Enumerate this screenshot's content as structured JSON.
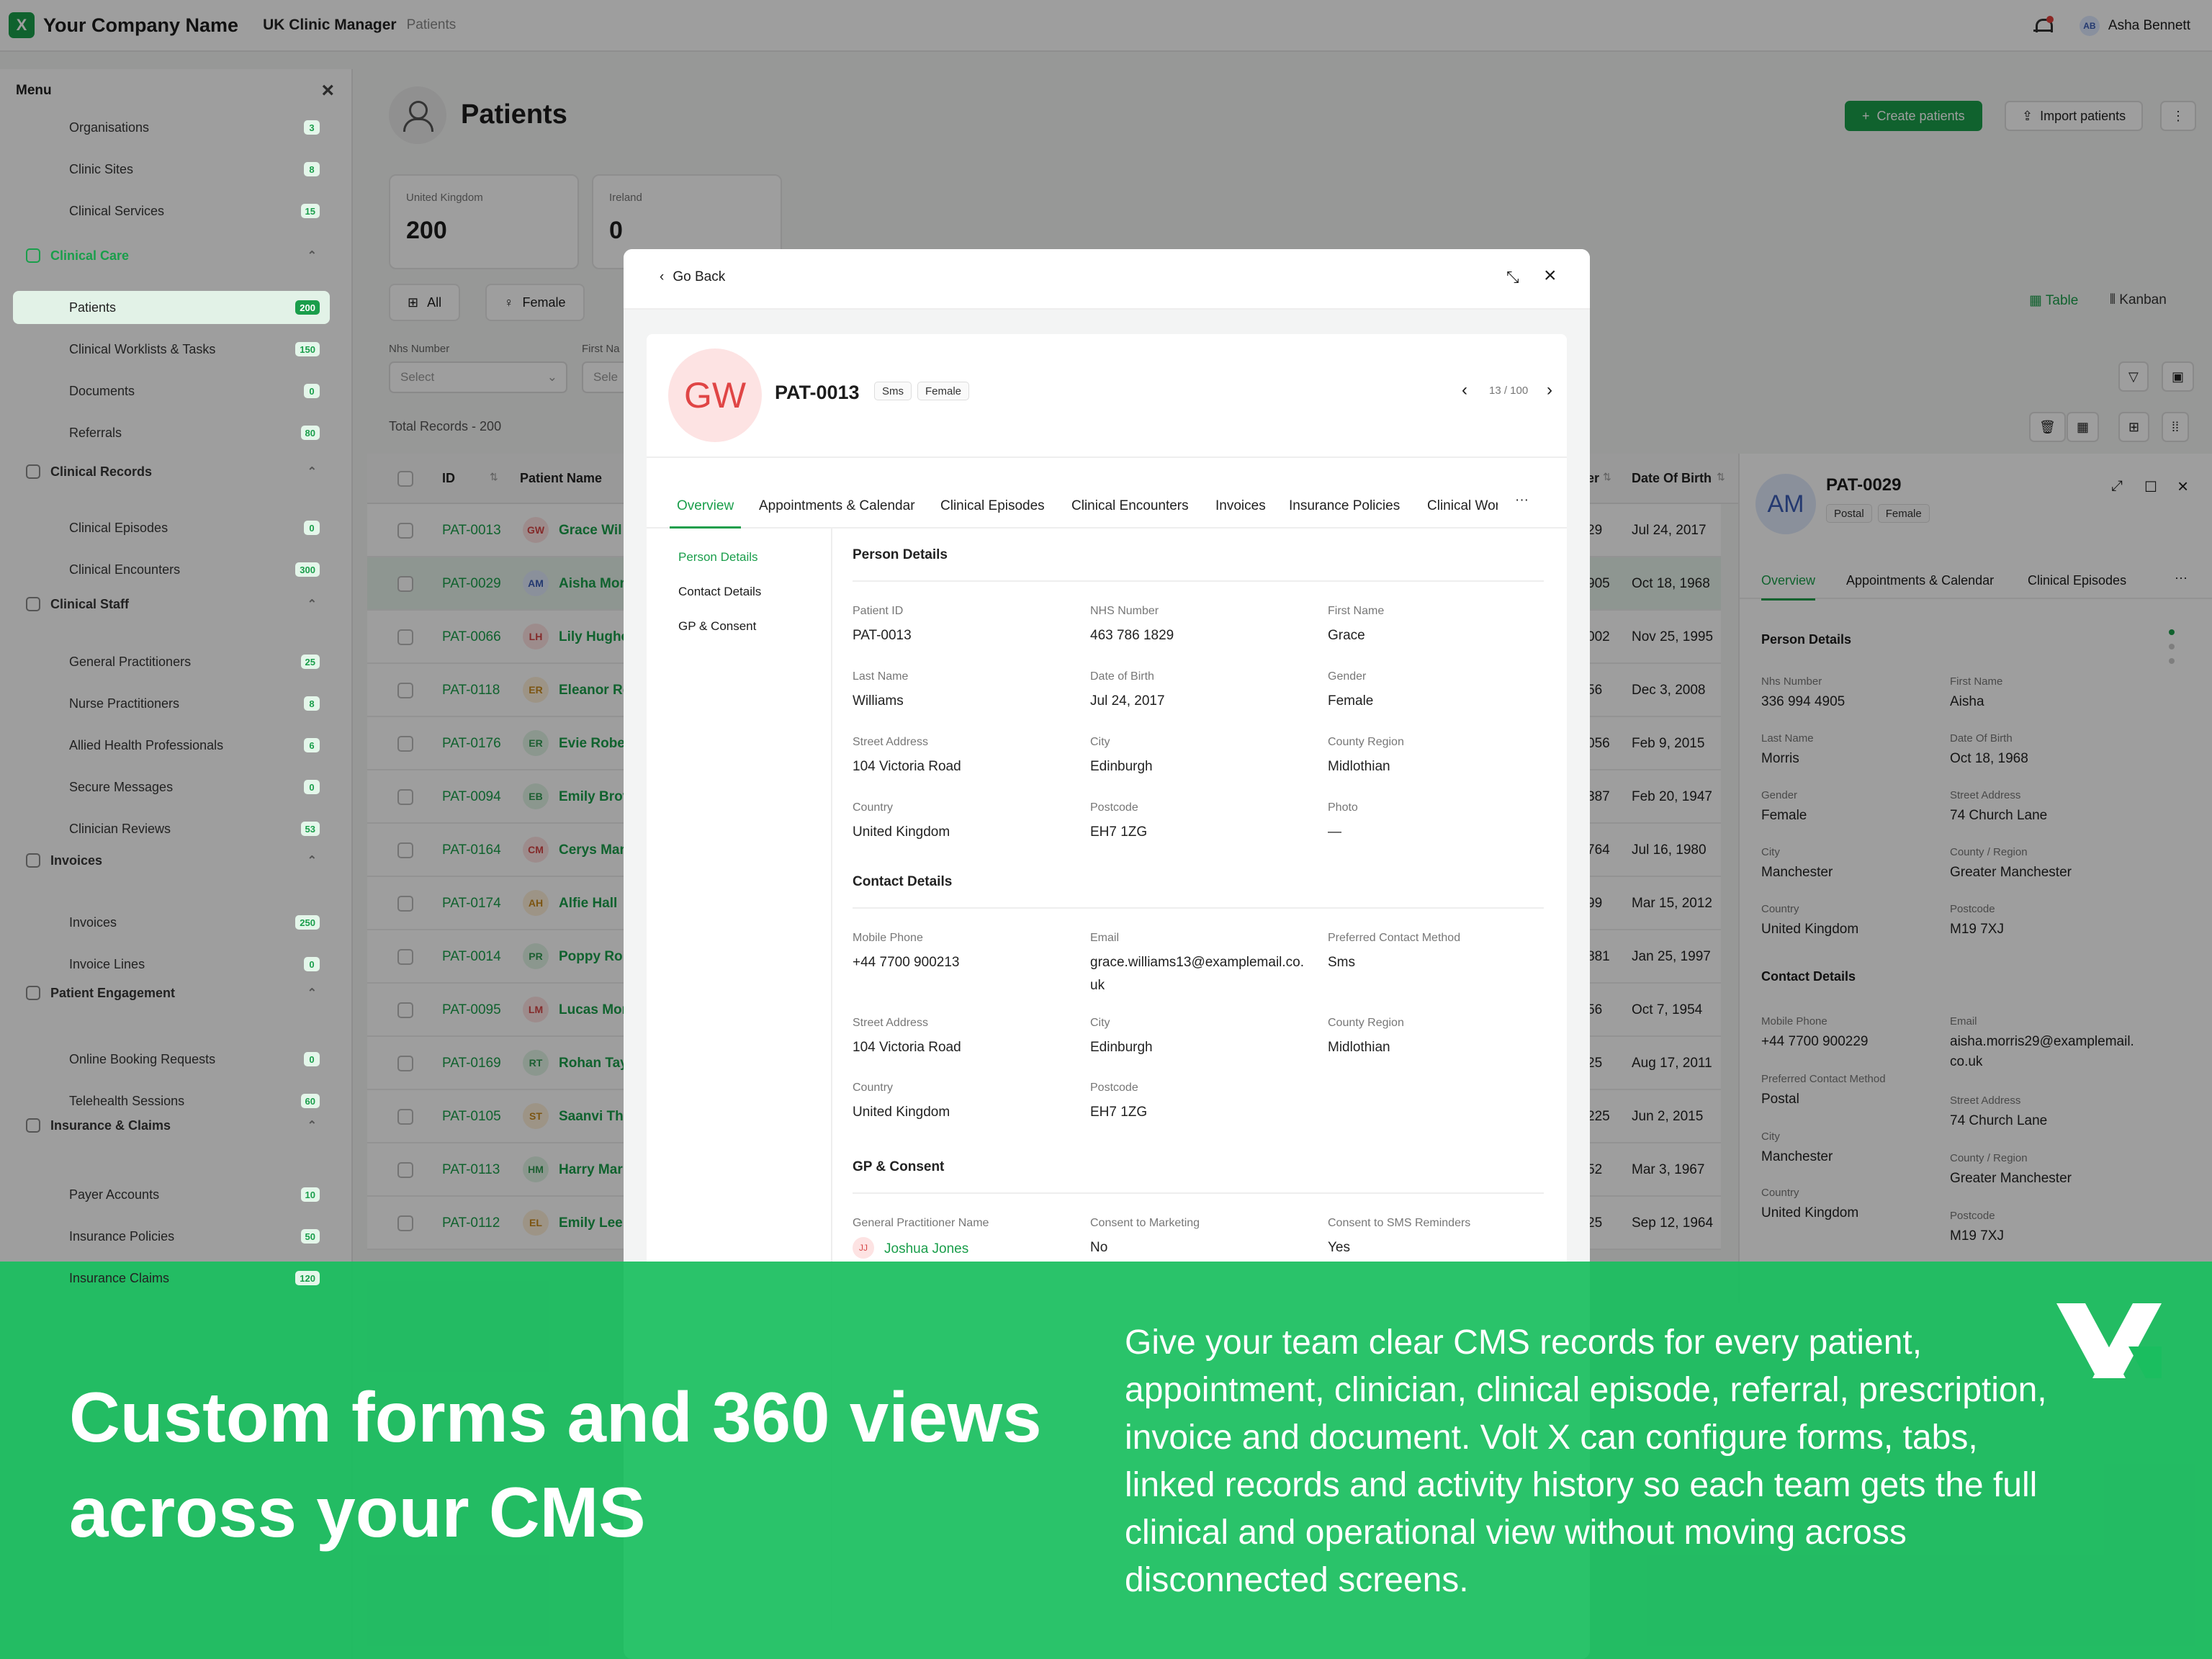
{
  "topbar": {
    "logo": "X",
    "company": "Your Company Name",
    "app": "UK Clinic Manager",
    "crumb": "Patients",
    "user_initials": "AB",
    "user": "Asha Bennett"
  },
  "sidebar": {
    "title": "Menu",
    "items": [
      {
        "label": "Organisations",
        "count": "3"
      },
      {
        "label": "Clinic Sites",
        "count": "8"
      },
      {
        "label": "Clinical Services",
        "count": "15"
      },
      {
        "label": "Patients",
        "count": "200"
      },
      {
        "label": "Clinical Worklists & Tasks",
        "count": "150"
      },
      {
        "label": "Documents",
        "count": "0"
      },
      {
        "label": "Referrals",
        "count": "80"
      },
      {
        "label": "Clinical Episodes",
        "count": "0"
      },
      {
        "label": "Clinical Encounters",
        "count": "300"
      },
      {
        "label": "General Practitioners",
        "count": "25"
      },
      {
        "label": "Nurse Practitioners",
        "count": "8"
      },
      {
        "label": "Allied Health Professionals",
        "count": "6"
      },
      {
        "label": "Secure Messages",
        "count": "0"
      },
      {
        "label": "Clinician Reviews",
        "count": "53"
      },
      {
        "label": "Invoices",
        "count": "250"
      },
      {
        "label": "Invoice Lines",
        "count": "0"
      },
      {
        "label": "Online Booking Requests",
        "count": "0"
      },
      {
        "label": "Telehealth Sessions",
        "count": "60"
      },
      {
        "label": "Payer Accounts",
        "count": "10"
      },
      {
        "label": "Insurance Policies",
        "count": "50"
      },
      {
        "label": "Insurance Claims",
        "count": "120"
      }
    ],
    "groups": [
      "Clinical Care",
      "Clinical Records",
      "Clinical Staff",
      "Invoices",
      "Patient Engagement",
      "Insurance & Claims"
    ]
  },
  "page": {
    "title": "Patients",
    "create": "Create patients",
    "import": "Import patients",
    "stats": [
      {
        "label": "United Kingdom",
        "value": "200"
      },
      {
        "label": "Ireland",
        "value": "0"
      }
    ],
    "filters": {
      "all": "All",
      "female": "Female"
    },
    "views": {
      "table": "Table",
      "kanban": "Kanban"
    },
    "filter_labels": {
      "nhs": "Nhs Number",
      "first": "First Na"
    },
    "select": "Select",
    "select2": "Sele",
    "total": "Total Records - 200",
    "columns": {
      "id": "ID",
      "name": "Patient Name",
      "col_er": "er",
      "dob": "Date Of Birth"
    }
  },
  "rows": [
    {
      "id": "PAT-0013",
      "ini": "GW",
      "name": "Grace Wil",
      "num": "29",
      "dob": "Jul 24, 2017",
      "bg": "#fde3e3",
      "fg": "#d64545"
    },
    {
      "id": "PAT-0029",
      "ini": "AM",
      "name": "Aisha Mor",
      "num": "905",
      "dob": "Oct 18, 1968",
      "bg": "#dfe8fb",
      "fg": "#3a5db5"
    },
    {
      "id": "PAT-0066",
      "ini": "LH",
      "name": "Lily Hughe",
      "num": "002",
      "dob": "Nov 25, 1995",
      "bg": "#fde3e3",
      "fg": "#d64545"
    },
    {
      "id": "PAT-0118",
      "ini": "ER",
      "name": "Eleanor Re",
      "num": "56",
      "dob": "Dec 3, 2008",
      "bg": "#fdefd8",
      "fg": "#c98a1e"
    },
    {
      "id": "PAT-0176",
      "ini": "ER",
      "name": "Evie Robe",
      "num": "056",
      "dob": "Feb 9, 2015",
      "bg": "#e1f4e6",
      "fg": "#2f9a52"
    },
    {
      "id": "PAT-0094",
      "ini": "EB",
      "name": "Emily Brov",
      "num": "387",
      "dob": "Feb 20, 1947",
      "bg": "#e1f4e6",
      "fg": "#2f9a52"
    },
    {
      "id": "PAT-0164",
      "ini": "CM",
      "name": "Cerys Mar",
      "num": "764",
      "dob": "Jul 16, 1980",
      "bg": "#fde3e3",
      "fg": "#d64545"
    },
    {
      "id": "PAT-0174",
      "ini": "AH",
      "name": "Alfie Hall",
      "num": "99",
      "dob": "Mar 15, 2012",
      "bg": "#fdefd8",
      "fg": "#c98a1e"
    },
    {
      "id": "PAT-0014",
      "ini": "PR",
      "name": "Poppy Rol",
      "num": "881",
      "dob": "Jan 25, 1997",
      "bg": "#e1f4e6",
      "fg": "#2f9a52"
    },
    {
      "id": "PAT-0095",
      "ini": "LM",
      "name": "Lucas Mor",
      "num": "56",
      "dob": "Oct 7, 1954",
      "bg": "#fde3e3",
      "fg": "#d64545"
    },
    {
      "id": "PAT-0169",
      "ini": "RT",
      "name": "Rohan Tay",
      "num": "25",
      "dob": "Aug 17, 2011",
      "bg": "#e1f4e6",
      "fg": "#2f9a52"
    },
    {
      "id": "PAT-0105",
      "ini": "ST",
      "name": "Saanvi Th",
      "num": "225",
      "dob": "Jun 2, 2015",
      "bg": "#fdefd8",
      "fg": "#c98a1e"
    },
    {
      "id": "PAT-0113",
      "ini": "HM",
      "name": "Harry Mar",
      "num": "52",
      "dob": "Mar 3, 1967",
      "bg": "#e1f4e6",
      "fg": "#2f9a52"
    },
    {
      "id": "PAT-0112",
      "ini": "EL",
      "name": "Emily Lee",
      "num": "25",
      "dob": "Sep 12, 1964",
      "bg": "#fdefd8",
      "fg": "#c98a1e"
    }
  ],
  "rpanel": {
    "initials": "AM",
    "id": "PAT-0029",
    "tags": [
      "Postal",
      "Female"
    ],
    "tabs": [
      "Overview",
      "Appointments & Calendar",
      "Clinical Episodes"
    ],
    "person": "Person Details",
    "contact": "Contact Details",
    "fields": [
      [
        "Nhs Number",
        "336 994 4905"
      ],
      [
        "First Name",
        "Aisha"
      ],
      [
        "Last Name",
        "Morris"
      ],
      [
        "Date Of Birth",
        "Oct 18, 1968"
      ],
      [
        "Gender",
        "Female"
      ],
      [
        "Street Address",
        "74 Church Lane"
      ],
      [
        "City",
        "Manchester"
      ],
      [
        "County / Region",
        "Greater Manchester"
      ],
      [
        "Country",
        "United Kingdom"
      ],
      [
        "Postcode",
        "M19 7XJ"
      ]
    ],
    "cfields": [
      [
        "Mobile Phone",
        "+44 7700 900229"
      ],
      [
        "Email",
        "aisha.morris29@examplemail.",
        "co.uk"
      ],
      [
        "Preferred Contact Method",
        "Postal"
      ],
      [
        "Street Address",
        "74 Church Lane"
      ],
      [
        "City",
        "Manchester"
      ],
      [
        "County / Region",
        "Greater Manchester"
      ],
      [
        "Country",
        "United Kingdom"
      ],
      [
        "Postcode",
        "M19 7XJ"
      ]
    ]
  },
  "modal": {
    "back": "Go Back",
    "initials": "GW",
    "id": "PAT-0013",
    "tags": [
      "Sms",
      "Female"
    ],
    "pager": "13 / 100",
    "tabs": [
      "Overview",
      "Appointments & Calendar",
      "Clinical Episodes",
      "Clinical Encounters",
      "Invoices",
      "Insurance Policies",
      "Clinical Wor"
    ],
    "nav": [
      "Person Details",
      "Contact Details",
      "GP & Consent"
    ],
    "person_title": "Person Details",
    "person": [
      [
        "Patient ID",
        "PAT-0013"
      ],
      [
        "NHS Number",
        "463 786 1829"
      ],
      [
        "First Name",
        "Grace"
      ],
      [
        "Last Name",
        "Williams"
      ],
      [
        "Date of Birth",
        "Jul 24, 2017"
      ],
      [
        "Gender",
        "Female"
      ],
      [
        "Street Address",
        "104 Victoria Road"
      ],
      [
        "City",
        "Edinburgh"
      ],
      [
        "County Region",
        "Midlothian"
      ],
      [
        "Country",
        "United Kingdom"
      ],
      [
        "Postcode",
        "EH7 1ZG"
      ],
      [
        "Photo",
        "—"
      ]
    ],
    "contact_title": "Contact Details",
    "contact": [
      [
        "Mobile Phone",
        "+44 7700 900213"
      ],
      [
        "Email",
        "grace.williams13@examplemail.co."
      ],
      [
        "Preferred Contact Method",
        "Sms"
      ],
      [
        "Street Address",
        "104 Victoria Road"
      ],
      [
        "City",
        "Edinburgh"
      ],
      [
        "County Region",
        "Midlothian"
      ],
      [
        "Country",
        "United Kingdom"
      ],
      [
        "Postcode",
        "EH7 1ZG"
      ]
    ],
    "email_cont": "uk",
    "gp_title": "GP & Consent",
    "gp": [
      [
        "General Practitioner Name",
        "Joshua Jones"
      ],
      [
        "Consent to Marketing",
        "No"
      ],
      [
        "Consent to SMS Reminders",
        "Yes"
      ]
    ],
    "gp_initials": "JJ"
  },
  "banner": {
    "headline": "Custom forms and 360 views across your CMS",
    "body": "Give your team clear CMS records for every patient, appointment, clinician, clinical episode, referral, prescription, invoice and document. Volt X can configure forms, tabs, linked records and activity history so each team gets the full clinical and operational view without moving across disconnected screens."
  }
}
